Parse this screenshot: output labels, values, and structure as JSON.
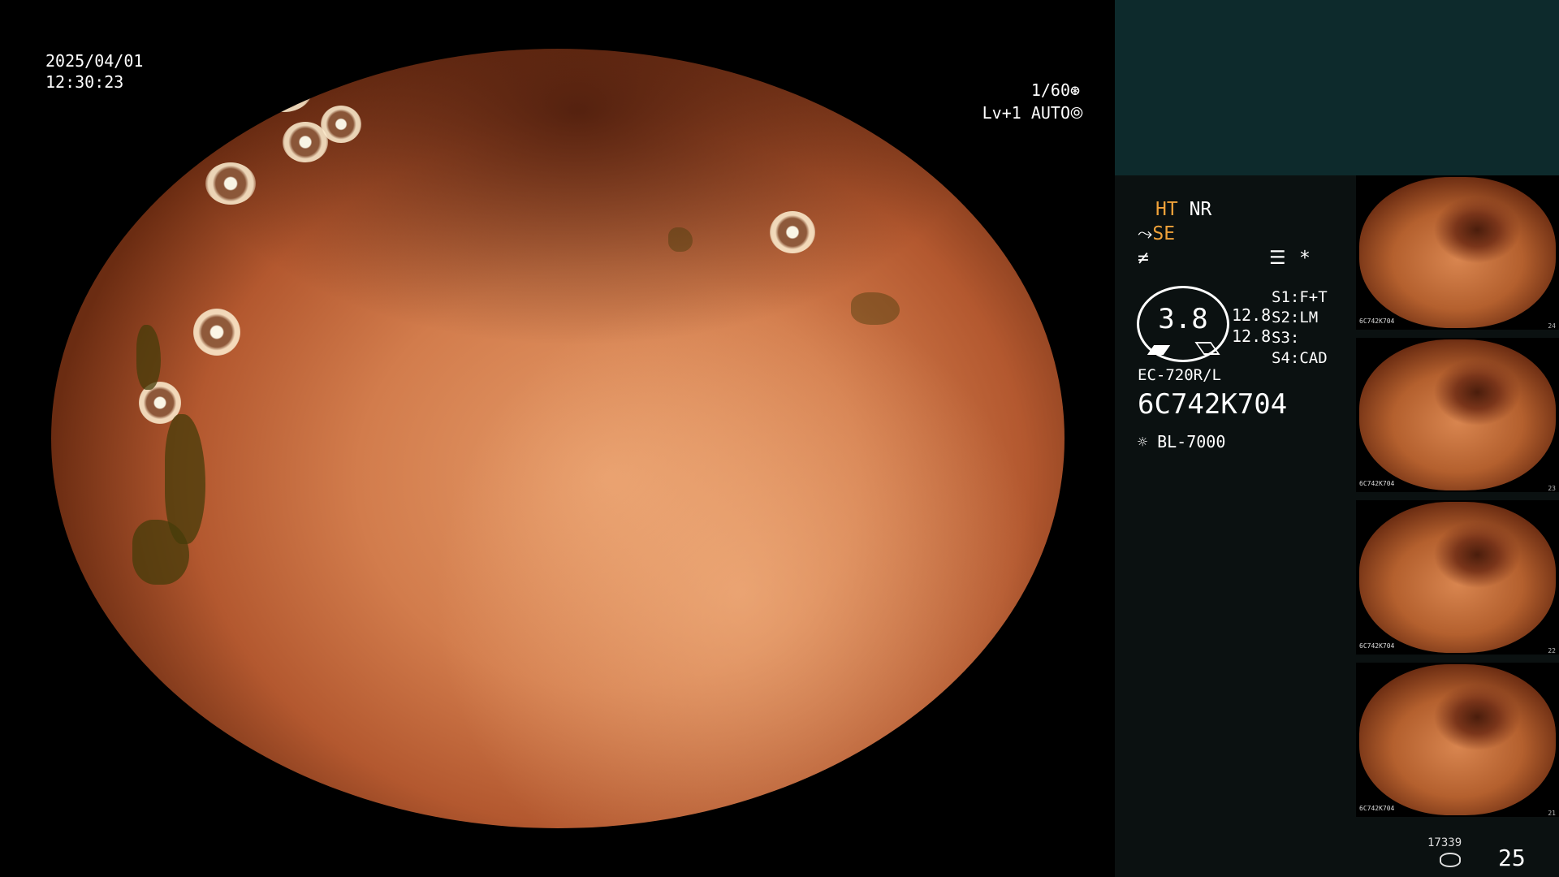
{
  "overlay": {
    "date": "2025/04/01",
    "time": "12:30:23",
    "shutter": "1/60",
    "shutter_icon": "aperture-icon",
    "level": "Lv+1",
    "mode": "AUTO",
    "mode_icon": "iris-icon"
  },
  "panel": {
    "ht": "HT",
    "nr": "NR",
    "se": "SE",
    "se_icon": "scope-tilt-icon",
    "function_icon": "freeze-icon",
    "menu_icon": "settings-list-icon",
    "asterisk": "*",
    "gauge_value": "3.8",
    "readout_1": "12.8",
    "readout_2": "12.8",
    "s1_label": "S1:",
    "s1_value": "F+T",
    "s2_label": "S2:",
    "s2_value": "LM",
    "s3_label": "S3:",
    "s3_value": "",
    "s4_label": "S4:",
    "s4_value": "CAD",
    "scope_model": "EC-720R/L",
    "scope_serial": "6C742K704",
    "light_icon": "light-source-icon",
    "light_source": "BL-7000"
  },
  "thumbnails": [
    {
      "id": "6C742K704",
      "number": "24"
    },
    {
      "id": "6C742K704",
      "number": "23"
    },
    {
      "id": "6C742K704",
      "number": "22"
    },
    {
      "id": "6C742K704",
      "number": "21"
    }
  ],
  "footer": {
    "image_count": "17339",
    "storage_icon": "database-icon",
    "page": "25"
  },
  "colors": {
    "accent": "#f0a23a",
    "panel_top": "#0d2a2c",
    "panel_bg": "#0b1111"
  }
}
